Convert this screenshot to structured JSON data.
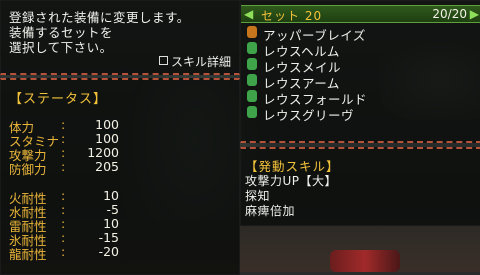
{
  "message": {
    "lines": [
      "登録された装備に変更します。",
      "装備するセットを",
      "選択して下さい。"
    ],
    "detail_label": "スキル詳細"
  },
  "status": {
    "header": "【ステータス】",
    "stats": [
      {
        "label": "体力",
        "value": "100"
      },
      {
        "label": "スタミナ",
        "value": "100"
      },
      {
        "label": "攻撃力",
        "value": "1200"
      },
      {
        "label": "防御力",
        "value": "205"
      }
    ],
    "resists": [
      {
        "label": "火耐性",
        "value": "10"
      },
      {
        "label": "水耐性",
        "value": "-5"
      },
      {
        "label": "雷耐性",
        "value": "10"
      },
      {
        "label": "氷耐性",
        "value": "-15"
      },
      {
        "label": "龍耐性",
        "value": "-20"
      }
    ],
    "colon": ":"
  },
  "set": {
    "name": "セット 20",
    "count": "20/20",
    "arrow_left": "◀",
    "arrow_right": "▶",
    "items": [
      {
        "name": "アッパーブレイズ",
        "icon": "weapon-icon",
        "color": "#c8761e"
      },
      {
        "name": "レウスヘルム",
        "icon": "helmet-icon",
        "color": "#3fa34a"
      },
      {
        "name": "レウスメイル",
        "icon": "chest-icon",
        "color": "#3fa34a"
      },
      {
        "name": "レウスアーム",
        "icon": "arm-icon",
        "color": "#3fa34a"
      },
      {
        "name": "レウスフォールド",
        "icon": "waist-icon",
        "color": "#3fa34a"
      },
      {
        "name": "レウスグリーヴ",
        "icon": "leg-icon",
        "color": "#3fa34a"
      }
    ]
  },
  "skills": {
    "header": "【発動スキル】",
    "list": [
      "攻撃力UP【大】",
      "探知",
      "麻痺倍加"
    ]
  }
}
